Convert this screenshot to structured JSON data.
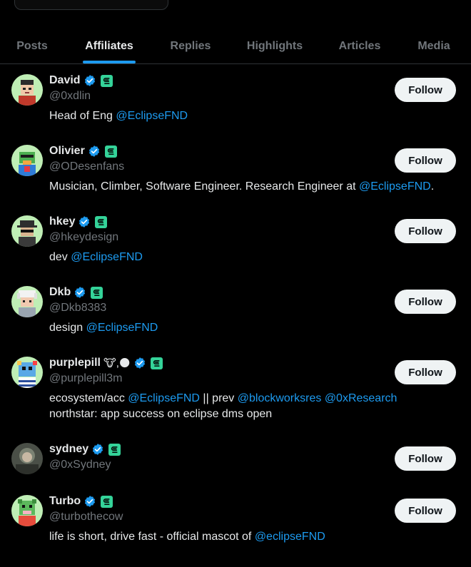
{
  "tabs": [
    {
      "label": "Posts",
      "active": false
    },
    {
      "label": "Affiliates",
      "active": true
    },
    {
      "label": "Replies",
      "active": false
    },
    {
      "label": "Highlights",
      "active": false
    },
    {
      "label": "Articles",
      "active": false
    },
    {
      "label": "Media",
      "active": false
    }
  ],
  "colors": {
    "background": "#000000",
    "accent": "#1d9bf0",
    "text": "#e7e9ea",
    "muted": "#71767b",
    "divider": "#2f3336",
    "affiliate_badge": "#34d399"
  },
  "affiliates": [
    {
      "name": "David",
      "handle": "@0xdlin",
      "bio_text": "Head of Eng ",
      "bio_link": "@EclipseFND",
      "bio_tail": "",
      "follow_label": "Follow"
    },
    {
      "name": "Olivier",
      "handle": "@ODesenfans",
      "bio_text": "Musician, Climber, Software Engineer. Research Engineer at ",
      "bio_link": "@EclipseFND",
      "bio_tail": ".",
      "follow_label": "Follow"
    },
    {
      "name": "hkey",
      "handle": "@hkeydesign",
      "bio_text": "dev ",
      "bio_link": "@EclipseFND",
      "bio_tail": "",
      "follow_label": "Follow"
    },
    {
      "name": "Dkb",
      "handle": "@Dkb8383",
      "bio_text": "design ",
      "bio_link": "@EclipseFND",
      "bio_tail": "",
      "follow_label": "Follow"
    },
    {
      "name": "purplepill",
      "name_emoji": "🐮,🌑",
      "handle": "@purplepill3m",
      "bio_text": "ecosystem/acc ",
      "bio_link": "@EclipseFND",
      "bio_mid": " || prev ",
      "bio_link2": "@blockworksres",
      "bio_link3": "@0xResearch",
      "bio_line2": "northstar: app success on eclipse dms open",
      "follow_label": "Follow"
    },
    {
      "name": "sydney",
      "handle": "@0xSydney",
      "follow_label": "Follow"
    },
    {
      "name": "Turbo",
      "handle": "@turbothecow",
      "bio_text": "life is short, drive fast - official mascot of ",
      "bio_link": "@eclipseFND",
      "bio_tail": "",
      "follow_label": "Follow"
    }
  ]
}
